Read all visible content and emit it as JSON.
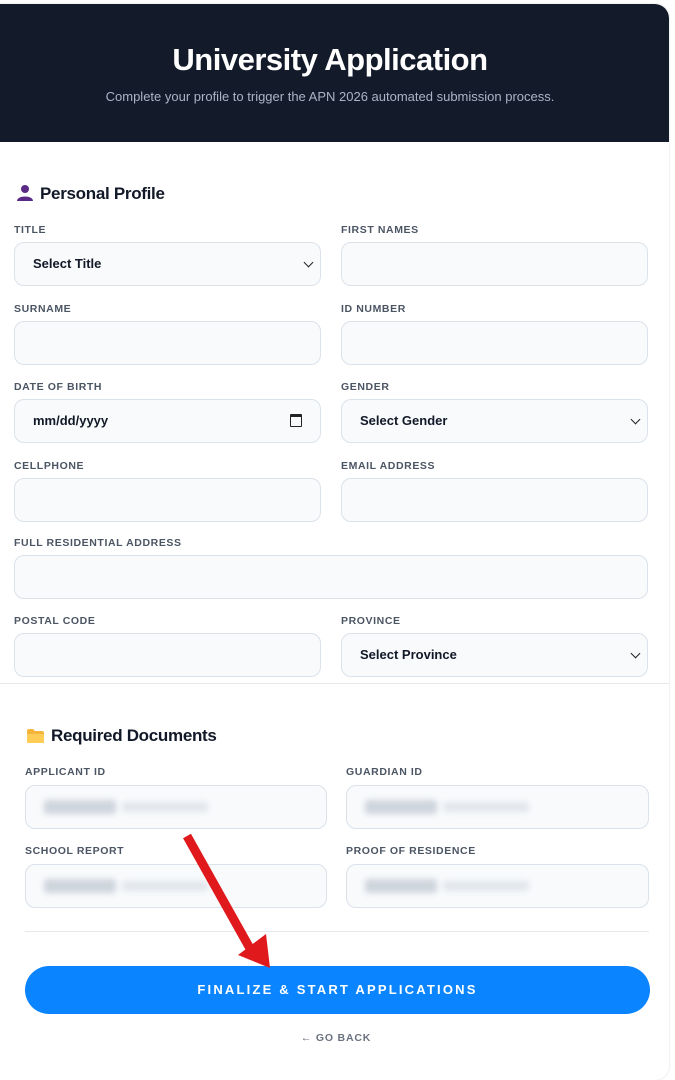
{
  "header": {
    "title": "University Application",
    "subtitle": "Complete your profile to trigger the APN 2026 automated submission process."
  },
  "personal": {
    "section_title": "Personal Profile",
    "section_icon": "person-icon",
    "title_label": "TITLE",
    "title_value": "Select Title",
    "first_names_label": "FIRST NAMES",
    "first_names_value": "",
    "surname_label": "SURNAME",
    "surname_value": "",
    "id_number_label": "ID NUMBER",
    "id_number_value": "",
    "dob_label": "DATE OF BIRTH",
    "dob_value": "mm/dd/yyyy",
    "gender_label": "GENDER",
    "gender_value": "Select Gender",
    "cellphone_label": "CELLPHONE",
    "cellphone_value": "",
    "email_label": "EMAIL ADDRESS",
    "email_value": "",
    "address_label": "FULL RESIDENTIAL ADDRESS",
    "address_value": "",
    "postal_label": "POSTAL CODE",
    "postal_value": "",
    "province_label": "PROVINCE",
    "province_value": "Select Province"
  },
  "documents": {
    "section_title": "Required Documents",
    "section_icon": "folder-icon",
    "applicant_id_label": "APPLICANT ID",
    "guardian_id_label": "GUARDIAN ID",
    "school_report_label": "SCHOOL REPORT",
    "proof_residence_label": "PROOF OF RESIDENCE"
  },
  "actions": {
    "submit_label": "FINALIZE & START APPLICATIONS",
    "back_label": "← GO BACK"
  },
  "colors": {
    "header_bg": "#131b2b",
    "primary": "#0a84ff",
    "annotation_arrow": "#e0191c"
  }
}
